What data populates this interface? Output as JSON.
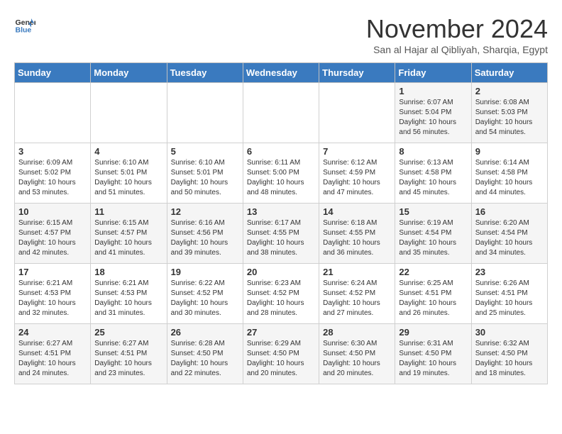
{
  "logo": {
    "line1": "General",
    "line2": "Blue"
  },
  "title": "November 2024",
  "location": "San al Hajar al Qibliyah, Sharqia, Egypt",
  "days_of_week": [
    "Sunday",
    "Monday",
    "Tuesday",
    "Wednesday",
    "Thursday",
    "Friday",
    "Saturday"
  ],
  "weeks": [
    [
      {
        "day": "",
        "info": ""
      },
      {
        "day": "",
        "info": ""
      },
      {
        "day": "",
        "info": ""
      },
      {
        "day": "",
        "info": ""
      },
      {
        "day": "",
        "info": ""
      },
      {
        "day": "1",
        "info": "Sunrise: 6:07 AM\nSunset: 5:04 PM\nDaylight: 10 hours\nand 56 minutes."
      },
      {
        "day": "2",
        "info": "Sunrise: 6:08 AM\nSunset: 5:03 PM\nDaylight: 10 hours\nand 54 minutes."
      }
    ],
    [
      {
        "day": "3",
        "info": "Sunrise: 6:09 AM\nSunset: 5:02 PM\nDaylight: 10 hours\nand 53 minutes."
      },
      {
        "day": "4",
        "info": "Sunrise: 6:10 AM\nSunset: 5:01 PM\nDaylight: 10 hours\nand 51 minutes."
      },
      {
        "day": "5",
        "info": "Sunrise: 6:10 AM\nSunset: 5:01 PM\nDaylight: 10 hours\nand 50 minutes."
      },
      {
        "day": "6",
        "info": "Sunrise: 6:11 AM\nSunset: 5:00 PM\nDaylight: 10 hours\nand 48 minutes."
      },
      {
        "day": "7",
        "info": "Sunrise: 6:12 AM\nSunset: 4:59 PM\nDaylight: 10 hours\nand 47 minutes."
      },
      {
        "day": "8",
        "info": "Sunrise: 6:13 AM\nSunset: 4:58 PM\nDaylight: 10 hours\nand 45 minutes."
      },
      {
        "day": "9",
        "info": "Sunrise: 6:14 AM\nSunset: 4:58 PM\nDaylight: 10 hours\nand 44 minutes."
      }
    ],
    [
      {
        "day": "10",
        "info": "Sunrise: 6:15 AM\nSunset: 4:57 PM\nDaylight: 10 hours\nand 42 minutes."
      },
      {
        "day": "11",
        "info": "Sunrise: 6:15 AM\nSunset: 4:57 PM\nDaylight: 10 hours\nand 41 minutes."
      },
      {
        "day": "12",
        "info": "Sunrise: 6:16 AM\nSunset: 4:56 PM\nDaylight: 10 hours\nand 39 minutes."
      },
      {
        "day": "13",
        "info": "Sunrise: 6:17 AM\nSunset: 4:55 PM\nDaylight: 10 hours\nand 38 minutes."
      },
      {
        "day": "14",
        "info": "Sunrise: 6:18 AM\nSunset: 4:55 PM\nDaylight: 10 hours\nand 36 minutes."
      },
      {
        "day": "15",
        "info": "Sunrise: 6:19 AM\nSunset: 4:54 PM\nDaylight: 10 hours\nand 35 minutes."
      },
      {
        "day": "16",
        "info": "Sunrise: 6:20 AM\nSunset: 4:54 PM\nDaylight: 10 hours\nand 34 minutes."
      }
    ],
    [
      {
        "day": "17",
        "info": "Sunrise: 6:21 AM\nSunset: 4:53 PM\nDaylight: 10 hours\nand 32 minutes."
      },
      {
        "day": "18",
        "info": "Sunrise: 6:21 AM\nSunset: 4:53 PM\nDaylight: 10 hours\nand 31 minutes."
      },
      {
        "day": "19",
        "info": "Sunrise: 6:22 AM\nSunset: 4:52 PM\nDaylight: 10 hours\nand 30 minutes."
      },
      {
        "day": "20",
        "info": "Sunrise: 6:23 AM\nSunset: 4:52 PM\nDaylight: 10 hours\nand 28 minutes."
      },
      {
        "day": "21",
        "info": "Sunrise: 6:24 AM\nSunset: 4:52 PM\nDaylight: 10 hours\nand 27 minutes."
      },
      {
        "day": "22",
        "info": "Sunrise: 6:25 AM\nSunset: 4:51 PM\nDaylight: 10 hours\nand 26 minutes."
      },
      {
        "day": "23",
        "info": "Sunrise: 6:26 AM\nSunset: 4:51 PM\nDaylight: 10 hours\nand 25 minutes."
      }
    ],
    [
      {
        "day": "24",
        "info": "Sunrise: 6:27 AM\nSunset: 4:51 PM\nDaylight: 10 hours\nand 24 minutes."
      },
      {
        "day": "25",
        "info": "Sunrise: 6:27 AM\nSunset: 4:51 PM\nDaylight: 10 hours\nand 23 minutes."
      },
      {
        "day": "26",
        "info": "Sunrise: 6:28 AM\nSunset: 4:50 PM\nDaylight: 10 hours\nand 22 minutes."
      },
      {
        "day": "27",
        "info": "Sunrise: 6:29 AM\nSunset: 4:50 PM\nDaylight: 10 hours\nand 20 minutes."
      },
      {
        "day": "28",
        "info": "Sunrise: 6:30 AM\nSunset: 4:50 PM\nDaylight: 10 hours\nand 20 minutes."
      },
      {
        "day": "29",
        "info": "Sunrise: 6:31 AM\nSunset: 4:50 PM\nDaylight: 10 hours\nand 19 minutes."
      },
      {
        "day": "30",
        "info": "Sunrise: 6:32 AM\nSunset: 4:50 PM\nDaylight: 10 hours\nand 18 minutes."
      }
    ]
  ]
}
